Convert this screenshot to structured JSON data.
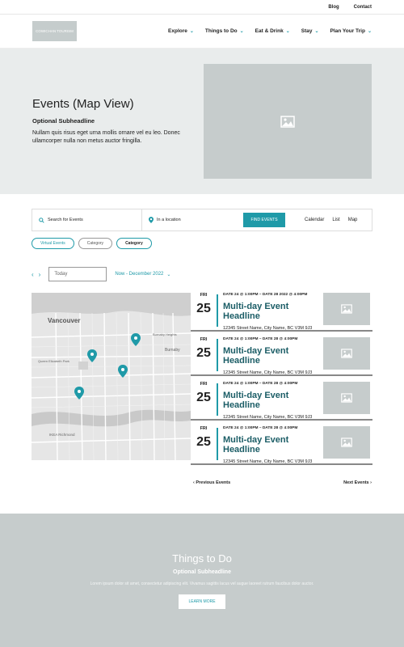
{
  "topbar": {
    "blog": "Blog",
    "contact": "Contact"
  },
  "nav": {
    "logo": "COWICHAN TOURISM",
    "items": [
      {
        "label": "Explore"
      },
      {
        "label": "Things to Do"
      },
      {
        "label": "Eat & Drink"
      },
      {
        "label": "Stay"
      },
      {
        "label": "Plan Your Trip"
      }
    ]
  },
  "hero": {
    "title": "Events (Map View)",
    "subheadline": "Optional Subheadline",
    "body": "Nullam quis risus eget urna mollis ornare vel eu leo. Donec ullamcorper nulla non metus auctor fringilla."
  },
  "search": {
    "search_placeholder": "Search for Events",
    "location_placeholder": "In a location",
    "find_button": "FIND EVENTS",
    "views": [
      "Calendar",
      "List",
      "Map"
    ]
  },
  "filters": [
    "Virtual Events",
    "Category",
    "Category"
  ],
  "datebar": {
    "today_placeholder": "Today",
    "range": "Now - December 2022"
  },
  "map": {
    "labels": [
      "Vancouver",
      "Burnaby Heights",
      "Burnaby",
      "Queen Elizabeth Park",
      "IKEA Richmond"
    ]
  },
  "events": [
    {
      "dow": "FRI",
      "day": "25",
      "dates": "DATE 24 @ 1:00PM – DATE 28 2022 @ 4:00PM",
      "headline": "Multi-day Event Headline",
      "address": "12345 Street Name, City Name, BC  V3M 9J3"
    },
    {
      "dow": "FRI",
      "day": "25",
      "dates": "DATE 24 @ 1:00PM – DATE 28 @ 4:00PM",
      "headline": "Multi-day Event Headline",
      "address": "12345 Street Name, City Name, BC  V3M 9J3"
    },
    {
      "dow": "FRI",
      "day": "25",
      "dates": "DATE 24 @ 1:00PM – DATE 28 @ 4:00PM",
      "headline": "Multi-day Event Headline",
      "address": "12345 Street Name, City Name, BC  V3M 9J3"
    },
    {
      "dow": "FRI",
      "day": "25",
      "dates": "DATE 24 @ 1:00PM – DATE 28 @ 4:00PM",
      "headline": "Multi-day Event Headline",
      "address": "12345 Street Name, City Name, BC  V3M 9J3"
    }
  ],
  "pager": {
    "previous": "Previous Events",
    "next": "Next Events"
  },
  "footer": {
    "title": "Things to Do",
    "subheadline": "Optional Subheadline",
    "body": "Lorem ipsum dolor sit amet, consectetur adipiscing elit. Vivamus sagittis lacus vel augue laoreet rutrum faucibus dolor auctor.",
    "button": "LEARN MORE"
  },
  "colors": {
    "accent": "#1f9aa8",
    "headline": "#1b5d66",
    "placeholder": "#c6cccc"
  }
}
